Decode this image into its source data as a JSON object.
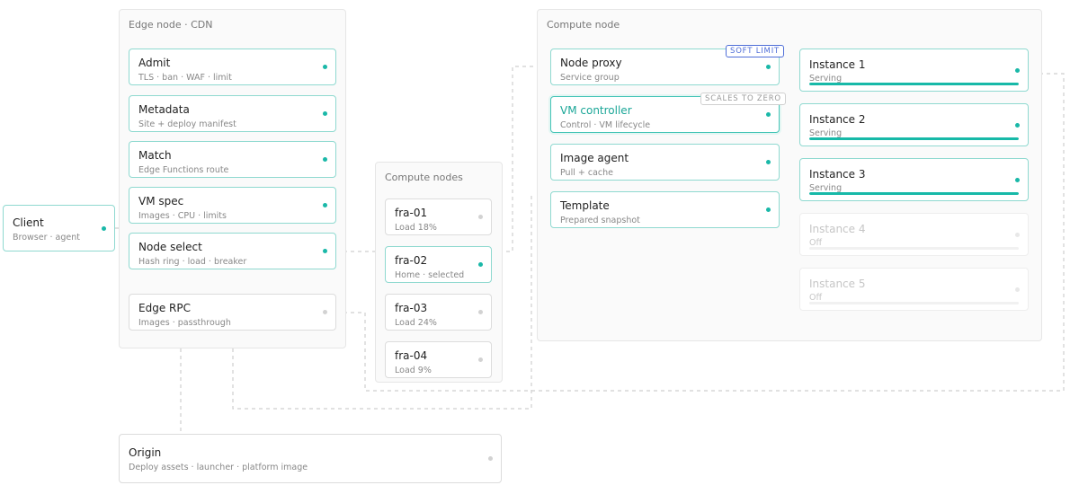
{
  "client": {
    "title": "Client",
    "sub": "Browser · agent"
  },
  "edge": {
    "title": "Edge node · CDN",
    "steps": [
      {
        "title": "Admit",
        "sub": "TLS · ban · WAF · limit"
      },
      {
        "title": "Metadata",
        "sub": "Site + deploy manifest"
      },
      {
        "title": "Match",
        "sub": "Edge Functions route"
      },
      {
        "title": "VM spec",
        "sub": "Images · CPU · limits"
      },
      {
        "title": "Node select",
        "sub": "Hash ring · load · breaker"
      }
    ],
    "rpc": {
      "title": "Edge RPC",
      "sub": "Images · passthrough"
    }
  },
  "compute_nodes": {
    "title": "Compute nodes",
    "items": [
      {
        "title": "fra-01",
        "sub": "Load 18%"
      },
      {
        "title": "fra-02",
        "sub": "Home · selected"
      },
      {
        "title": "fra-03",
        "sub": "Load 24%"
      },
      {
        "title": "fra-04",
        "sub": "Load 9%"
      }
    ]
  },
  "compute_node": {
    "title": "Compute node",
    "components": [
      {
        "title": "Node proxy",
        "sub": "Service group",
        "tag": "SOFT LIMIT"
      },
      {
        "title": "VM controller",
        "sub": "Control · VM lifecycle",
        "tag": "SCALES TO ZERO"
      },
      {
        "title": "Image agent",
        "sub": "Pull + cache"
      },
      {
        "title": "Template",
        "sub": "Prepared snapshot"
      }
    ],
    "instances": [
      {
        "title": "Instance 1",
        "status": "Serving",
        "level": 1
      },
      {
        "title": "Instance 2",
        "status": "Serving",
        "level": 1
      },
      {
        "title": "Instance 3",
        "status": "Serving",
        "level": 1
      },
      {
        "title": "Instance 4",
        "status": "Off",
        "level": 0
      },
      {
        "title": "Instance 5",
        "status": "Off",
        "level": 0
      }
    ]
  },
  "origin": {
    "title": "Origin",
    "sub": "Deploy assets · launcher · platform image"
  },
  "colors": {
    "accent": "#1ab8a8",
    "idle": "#d2d2d2",
    "soft_limit": "#4f6ed8"
  }
}
